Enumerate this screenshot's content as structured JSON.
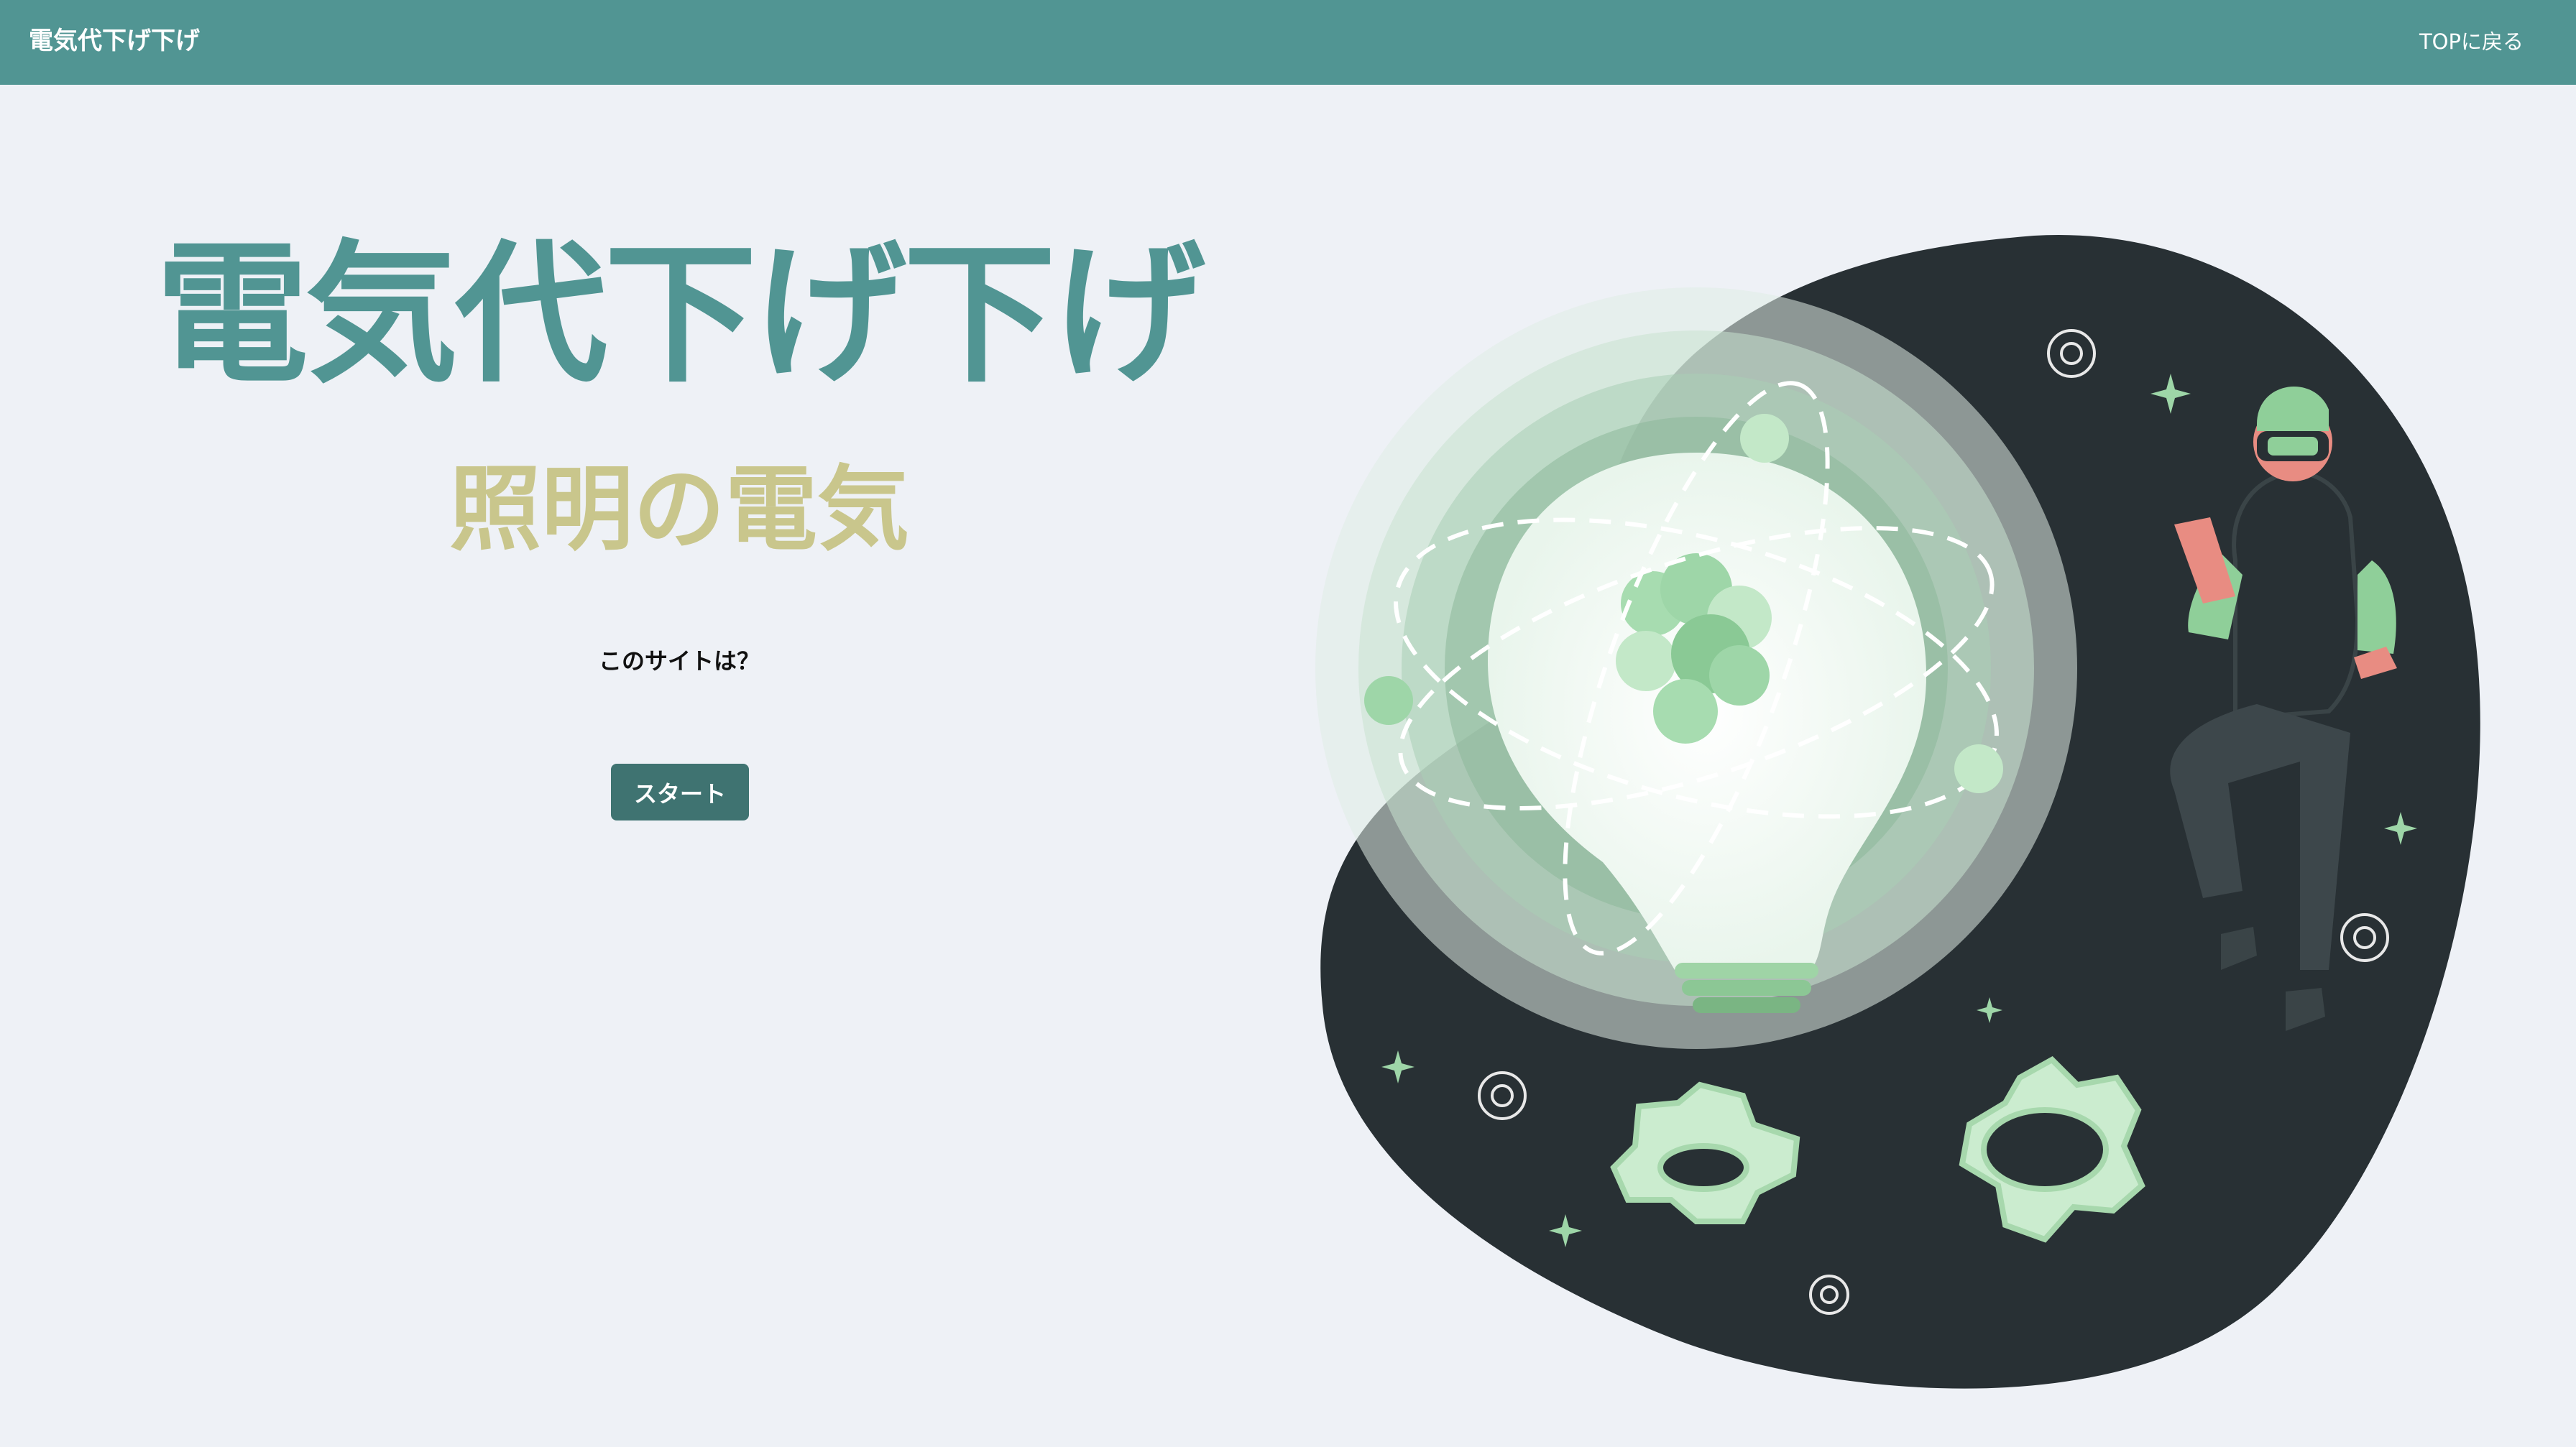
{
  "navbar": {
    "brand": "電気代下げ下げ",
    "top_link": "TOPに戻る"
  },
  "hero": {
    "title": "電気代下げ下げ",
    "subtitle": "照明の電気",
    "question": "このサイトは？",
    "start_button": "スタート"
  },
  "colors": {
    "navbar": "#519593",
    "title": "#519593",
    "subtitle": "#c9c68c",
    "button": "#3f7371",
    "background": "#eef1f6",
    "illustration_dark": "#283034",
    "illustration_green": "#cbeccf"
  },
  "illustration": {
    "description_icons": [
      "lightbulb-icon",
      "gear-icon",
      "sparkle-icon",
      "vr-person"
    ]
  }
}
